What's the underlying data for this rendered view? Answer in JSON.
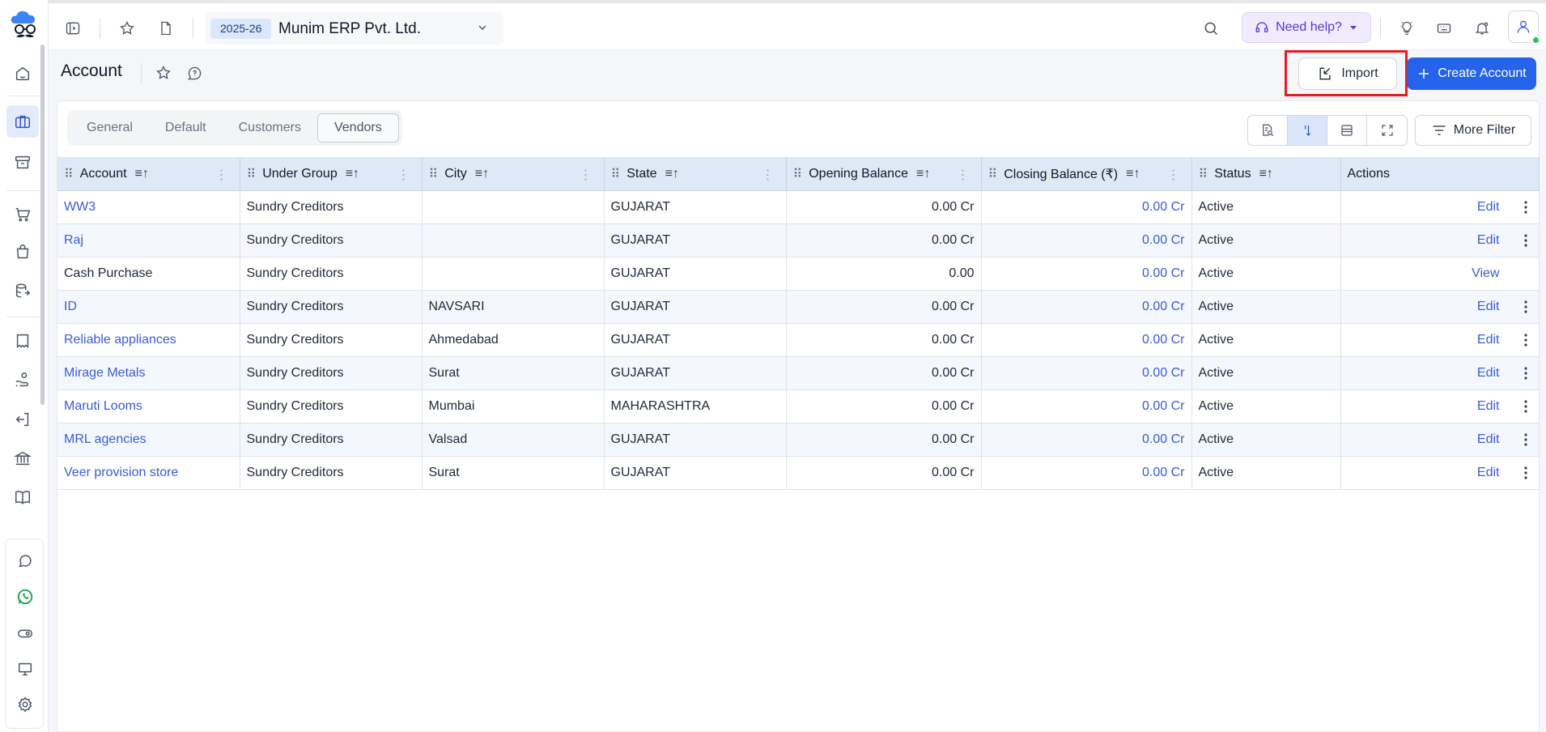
{
  "topbar": {
    "year": "2025-26",
    "company": "Munim ERP Pvt. Ltd.",
    "help_label": "Need help?"
  },
  "page": {
    "title": "Account",
    "import_label": "Import",
    "create_label": "Create Account"
  },
  "tabs": [
    "General",
    "Default",
    "Customers",
    "Vendors"
  ],
  "active_tab": "Vendors",
  "more_filter_label": "More Filter",
  "table": {
    "columns": [
      "Account",
      "Under Group",
      "City",
      "State",
      "Opening Balance",
      "Closing Balance (₹)",
      "Status",
      "Actions"
    ],
    "rows": [
      {
        "account": "WW3",
        "group": "Sundry Creditors",
        "city": "",
        "state": "GUJARAT",
        "opening": "0.00 Cr",
        "closing": "0.00 Cr",
        "status": "Active",
        "action": "Edit"
      },
      {
        "account": "Raj",
        "group": "Sundry Creditors",
        "city": "",
        "state": "GUJARAT",
        "opening": "0.00 Cr",
        "closing": "0.00 Cr",
        "status": "Active",
        "action": "Edit"
      },
      {
        "account": "Cash Purchase",
        "group": "Sundry Creditors",
        "city": "",
        "state": "GUJARAT",
        "opening": "0.00",
        "closing": "0.00 Cr",
        "status": "Active",
        "action": "View"
      },
      {
        "account": "ID",
        "group": "Sundry Creditors",
        "city": "NAVSARI",
        "state": "GUJARAT",
        "opening": "0.00 Cr",
        "closing": "0.00 Cr",
        "status": "Active",
        "action": "Edit"
      },
      {
        "account": "Reliable appliances",
        "group": "Sundry Creditors",
        "city": "Ahmedabad",
        "state": "GUJARAT",
        "opening": "0.00 Cr",
        "closing": "0.00 Cr",
        "status": "Active",
        "action": "Edit"
      },
      {
        "account": "Mirage Metals",
        "group": "Sundry Creditors",
        "city": "Surat",
        "state": "GUJARAT",
        "opening": "0.00 Cr",
        "closing": "0.00 Cr",
        "status": "Active",
        "action": "Edit"
      },
      {
        "account": "Maruti Looms",
        "group": "Sundry Creditors",
        "city": "Mumbai",
        "state": "MAHARASHTRA",
        "opening": "0.00 Cr",
        "closing": "0.00 Cr",
        "status": "Active",
        "action": "Edit"
      },
      {
        "account": "MRL agencies",
        "group": "Sundry Creditors",
        "city": "Valsad",
        "state": "GUJARAT",
        "opening": "0.00 Cr",
        "closing": "0.00 Cr",
        "status": "Active",
        "action": "Edit"
      },
      {
        "account": "Veer provision store",
        "group": "Sundry Creditors",
        "city": "Surat",
        "state": "GUJARAT",
        "opening": "0.00 Cr",
        "closing": "0.00 Cr",
        "status": "Active",
        "action": "Edit"
      }
    ]
  },
  "colors": {
    "primary": "#2563eb",
    "link": "#3b5bdb",
    "header_bg": "#dfe8f7",
    "highlight": "#e41e1e",
    "help": "#5b37d6"
  },
  "icons": {
    "sidebar": [
      "home-icon",
      "briefcase-icon",
      "archive-icon",
      "cart-icon",
      "shopping-bag-icon",
      "database-export-icon",
      "receipt-icon",
      "hand-coins-icon",
      "exit-door-icon",
      "bank-icon",
      "book-icon",
      "chat-icon",
      "whatsapp-icon",
      "toggle-icon",
      "monitor-icon",
      "gear-icon"
    ]
  }
}
